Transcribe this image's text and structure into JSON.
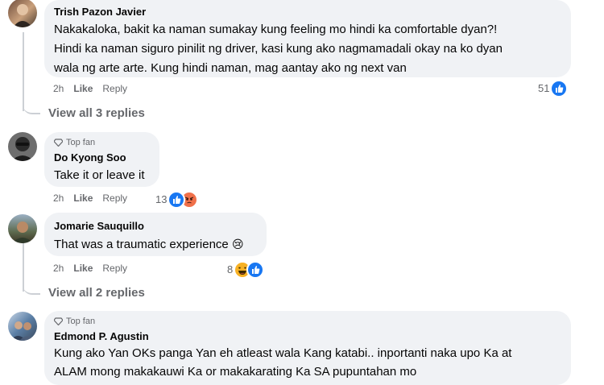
{
  "comments": [
    {
      "author": "Trish Pazon Javier",
      "lines": [
        "Nakakaloka, bakit ka naman sumakay kung feeling mo hindi ka comfortable dyan?!",
        "Hindi ka naman siguro pinilit ng driver, kasi kung ako nagmamadali okay na ko dyan",
        "wala ng arte arte. Kung hindi naman, mag aantay ako ng next van"
      ],
      "time": "2h",
      "like_label": "Like",
      "reply_label": "Reply",
      "reaction_count": "51",
      "view_replies": "View all 3 replies"
    },
    {
      "badge": "Top fan",
      "author": "Do Kyong Soo",
      "text": "Take it or leave it",
      "time": "2h",
      "like_label": "Like",
      "reply_label": "Reply",
      "reaction_count": "13"
    },
    {
      "author": "Jomarie Sauquillo",
      "text": "That was a traumatic experience",
      "emoji": "😢",
      "time": "2h",
      "like_label": "Like",
      "reply_label": "Reply",
      "reaction_count": "8",
      "view_replies": "View all 2 replies"
    },
    {
      "badge": "Top fan",
      "author": "Edmond P. Agustin",
      "lines": [
        "Kung ako Yan OKs panga Yan eh atleast wala Kang katabi.. inportanti naka upo Ka at",
        "ALAM mong makakauwi Ka or makakarating Ka SA pupuntahan mo"
      ]
    }
  ],
  "colors": {
    "bubble": "#f0f2f5",
    "meta_text": "#65676b",
    "like_blue": "#1877f2",
    "angry": "#f0704a",
    "haha": "#f7b125"
  },
  "icons": [
    "like-reaction-icon",
    "angry-reaction-icon",
    "haha-reaction-icon",
    "top-fan-diamond-icon"
  ]
}
